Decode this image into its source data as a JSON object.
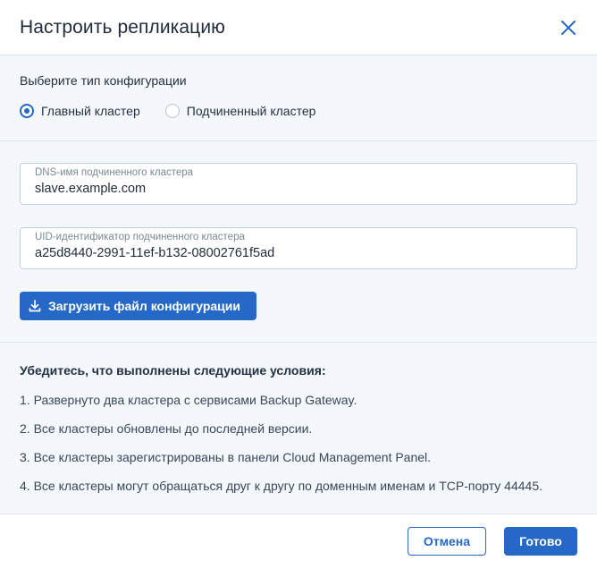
{
  "dialog": {
    "title": "Настроить репликацию",
    "close_icon": "close-icon"
  },
  "config": {
    "label": "Выберите тип конфигурации",
    "options": [
      {
        "label": "Главный кластер",
        "selected": true
      },
      {
        "label": "Подчиненный кластер",
        "selected": false
      }
    ]
  },
  "fields": {
    "dns": {
      "label": "DNS-имя подчиненного кластера",
      "value": "slave.example.com"
    },
    "uid": {
      "label": "UID-идентификатор подчиненного кластера",
      "value": "a25d8440-2991-11ef-b132-08002761f5ad"
    }
  },
  "upload": {
    "label": "Загрузить файл конфигурации",
    "icon": "download-icon"
  },
  "conditions": {
    "title": "Убедитесь, что выполнены следующие условия:",
    "items": [
      "1. Развернуто два кластера с сервисами Backup Gateway.",
      "2. Все кластеры обновлены до последней версии.",
      "3. Все кластеры зарегистрированы в панели Cloud Management Panel.",
      "4. Все кластеры могут обращаться друг к другу по доменным именам и TCP-порту 44445."
    ]
  },
  "footer": {
    "cancel_label": "Отмена",
    "done_label": "Готово"
  },
  "colors": {
    "accent": "#2668c5",
    "section_bg": "#f4f7fb",
    "text": "#243142"
  }
}
